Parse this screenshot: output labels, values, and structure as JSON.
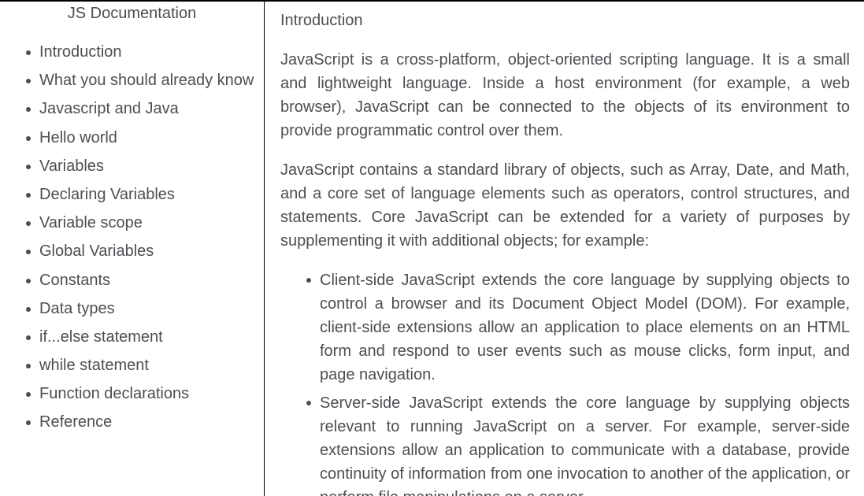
{
  "navbar": {
    "title": "JS Documentation",
    "links": [
      "Introduction",
      "What you should already know",
      "Javascript and Java",
      "Hello world",
      "Variables",
      "Declaring Variables",
      "Variable scope",
      "Global Variables",
      "Constants",
      "Data types",
      "if...else statement",
      "while statement",
      "Function declarations",
      "Reference"
    ]
  },
  "main": {
    "section_header": "Introduction",
    "paragraphs": [
      "JavaScript is a cross-platform, object-oriented scripting language. It is a small and lightweight language. Inside a host environment (for example, a web browser), JavaScript can be connected to the objects of its environment to provide programmatic control over them.",
      "JavaScript contains a standard library of objects, such as Array, Date, and Math, and a core set of language elements such as operators, control structures, and statements. Core JavaScript can be extended for a variety of purposes by supplementing it with additional objects; for example:"
    ],
    "list_items": [
      "Client-side JavaScript extends the core language by supplying objects to control a browser and its Document Object Model (DOM). For example, client-side extensions allow an application to place elements on an HTML form and respond to user events such as mouse clicks, form input, and page navigation.",
      "Server-side JavaScript extends the core language by supplying objects relevant to running JavaScript on a server. For example, server-side extensions allow an application to communicate with a database, provide continuity of information from one invocation to another of the application, or perform file manipulations on a server."
    ]
  }
}
